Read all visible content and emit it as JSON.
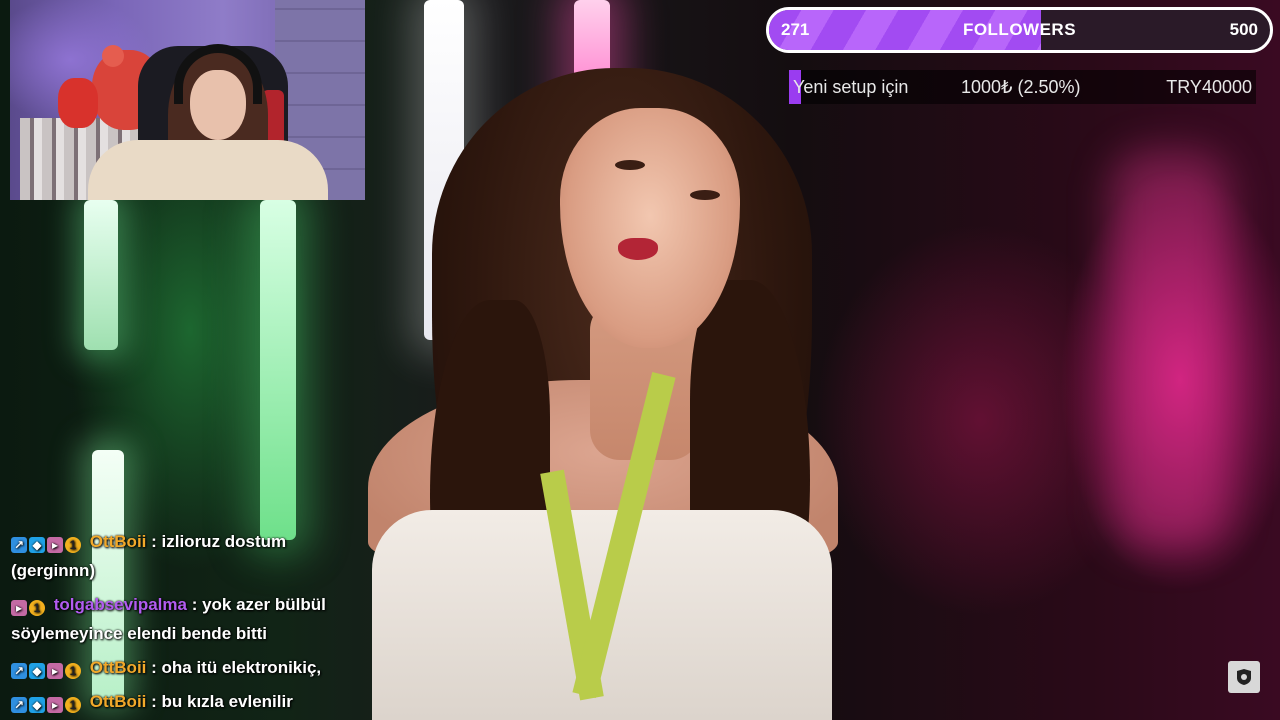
{
  "followers_widget": {
    "current": "271",
    "label": "FOLLOWERS",
    "goal": "500",
    "progress_fraction": 0.542,
    "fill_color": "#a24bf2"
  },
  "donation_goal": {
    "title": "Yeni setup için",
    "amount": "1000₺ (2.50%)",
    "goal": "TRY40000",
    "progress_fraction": 0.025,
    "fill_color": "#9a3cf0"
  },
  "chat": {
    "messages": [
      {
        "badges": [
          "prime-icon",
          "cube-icon",
          "sub-icon",
          "bits-icon"
        ],
        "user": "OttBoii",
        "user_color": "#f2a92a",
        "text": ": izlioruz dostum (gerginnn)"
      },
      {
        "badges": [
          "sub-icon",
          "bits-icon"
        ],
        "user": "tolgabsevipalma",
        "user_color": "#b25cf0",
        "text": ": yok azer bülbül söylemeyince elendi bende bitti"
      },
      {
        "badges": [
          "prime-icon",
          "cube-icon",
          "sub-icon",
          "bits-icon"
        ],
        "user": "OttBoii",
        "user_color": "#f2a92a",
        "text": ": oha itü elektronikiç,"
      },
      {
        "badges": [
          "prime-icon",
          "cube-icon",
          "sub-icon",
          "bits-icon"
        ],
        "user": "OttBoii",
        "user_color": "#f2a92a",
        "text": ": bu kızla evlenilir"
      }
    ]
  },
  "corner_button": {
    "icon": "shield-logo-icon"
  }
}
